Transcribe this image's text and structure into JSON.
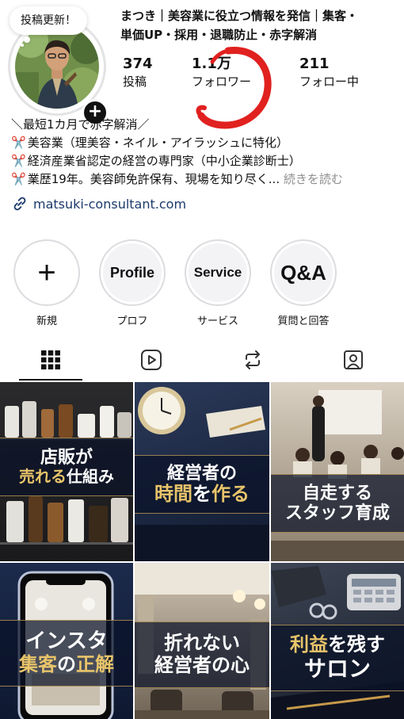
{
  "profile": {
    "note": "投稿更新！",
    "name_line1": "まつき｜美容業に役立つ情報を発信｜集客・",
    "name_line2": "単価UP・採用・退職防止・赤字解消",
    "stats": [
      {
        "num": "374",
        "label": "投稿"
      },
      {
        "num": "1.1万",
        "label": "フォロワー"
      },
      {
        "num": "211",
        "label": "フォロー中"
      }
    ],
    "bio": {
      "line1": "＼最短1カ月で赤字解消／",
      "line2": "美容業（理美容・ネイル・アイラッシュに特化）",
      "line3": "経済産業省認定の経営の専門家（中小企業診断士）",
      "line4": "業歴19年。美容師免許保有、現場を知り尽く...",
      "more": "続きを読む",
      "scissor": "✂️"
    },
    "link": "matsuki-consultant.com",
    "accent_red": "#e0211f"
  },
  "highlights": [
    {
      "cover": "+",
      "label": "新規"
    },
    {
      "cover": "Profile",
      "label": "プロフ"
    },
    {
      "cover": "Service",
      "label": "サービス"
    },
    {
      "cover": "Q&A",
      "label": "質問と回答"
    }
  ],
  "tabs": [
    "grid-icon",
    "reels-icon",
    "reposts-icon",
    "tagged-icon"
  ],
  "posts": [
    {
      "l1a": "店販",
      "l1b": "が",
      "l2a": "売れる",
      "l2b": "仕組み"
    },
    {
      "l1a": "経営者の",
      "l2a": "時間",
      "l2b": "を",
      "l2c": "作る"
    },
    {
      "l1a": "自走する",
      "l2a": "スタッフ育成"
    },
    {
      "l1a": "インスタ",
      "l2a": "集客",
      "l2b": "の",
      "l2c": "正解"
    },
    {
      "l1a": "折れない",
      "l2a": "経営者の心"
    },
    {
      "l1a": "利益",
      "l1b": "を残す",
      "l2a": "サロン"
    }
  ]
}
